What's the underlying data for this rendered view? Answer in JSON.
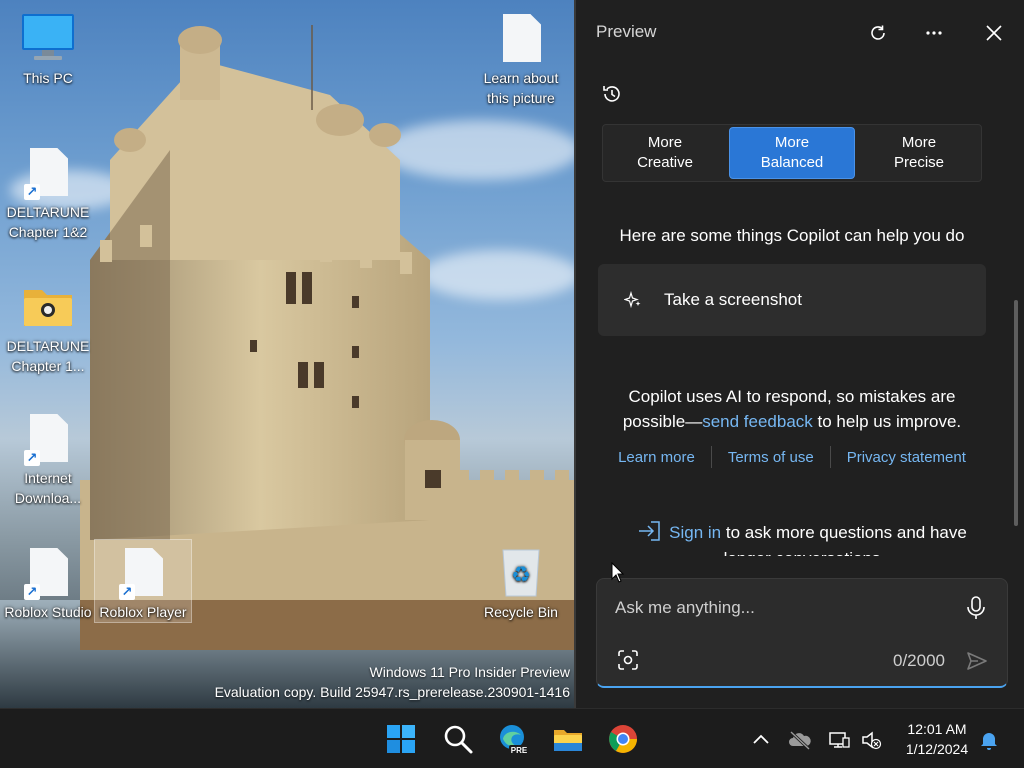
{
  "desktop": {
    "icons": [
      {
        "label": "This PC"
      },
      {
        "label": "Learn about this picture"
      },
      {
        "label": "DELTARUNE Chapter 1&2"
      },
      {
        "label": "DELTARUNE Chapter 1..."
      },
      {
        "label": "Internet Downloa..."
      },
      {
        "label": "Roblox Studio"
      },
      {
        "label": "Roblox Player"
      },
      {
        "label": "Recycle Bin"
      }
    ],
    "watermark": {
      "line1": "Windows 11 Pro Insider Preview",
      "line2": "Evaluation copy. Build 25947.rs_prerelease.230901-1416"
    }
  },
  "copilot": {
    "title": "Preview",
    "modes": [
      {
        "label": "More\nCreative"
      },
      {
        "label": "More\nBalanced"
      },
      {
        "label": "More\nPrecise"
      }
    ],
    "help_title": "Here are some things Copilot can help you do",
    "suggestion": "Take a screenshot",
    "disclaimer": {
      "before": "Copilot uses AI to respond, so mistakes are possible—",
      "link": "send feedback",
      "after": " to help us improve."
    },
    "links": {
      "learn_more": "Learn more",
      "terms": "Terms of use",
      "privacy": "Privacy statement"
    },
    "signin": {
      "link": "Sign in",
      "text": " to ask more questions and have longer conversations"
    },
    "ask": {
      "placeholder": "Ask me anything...",
      "counter": "0/2000"
    }
  },
  "taskbar": {
    "time": "12:01 AM",
    "date": "1/12/2024",
    "edge_badge": "PRE"
  }
}
